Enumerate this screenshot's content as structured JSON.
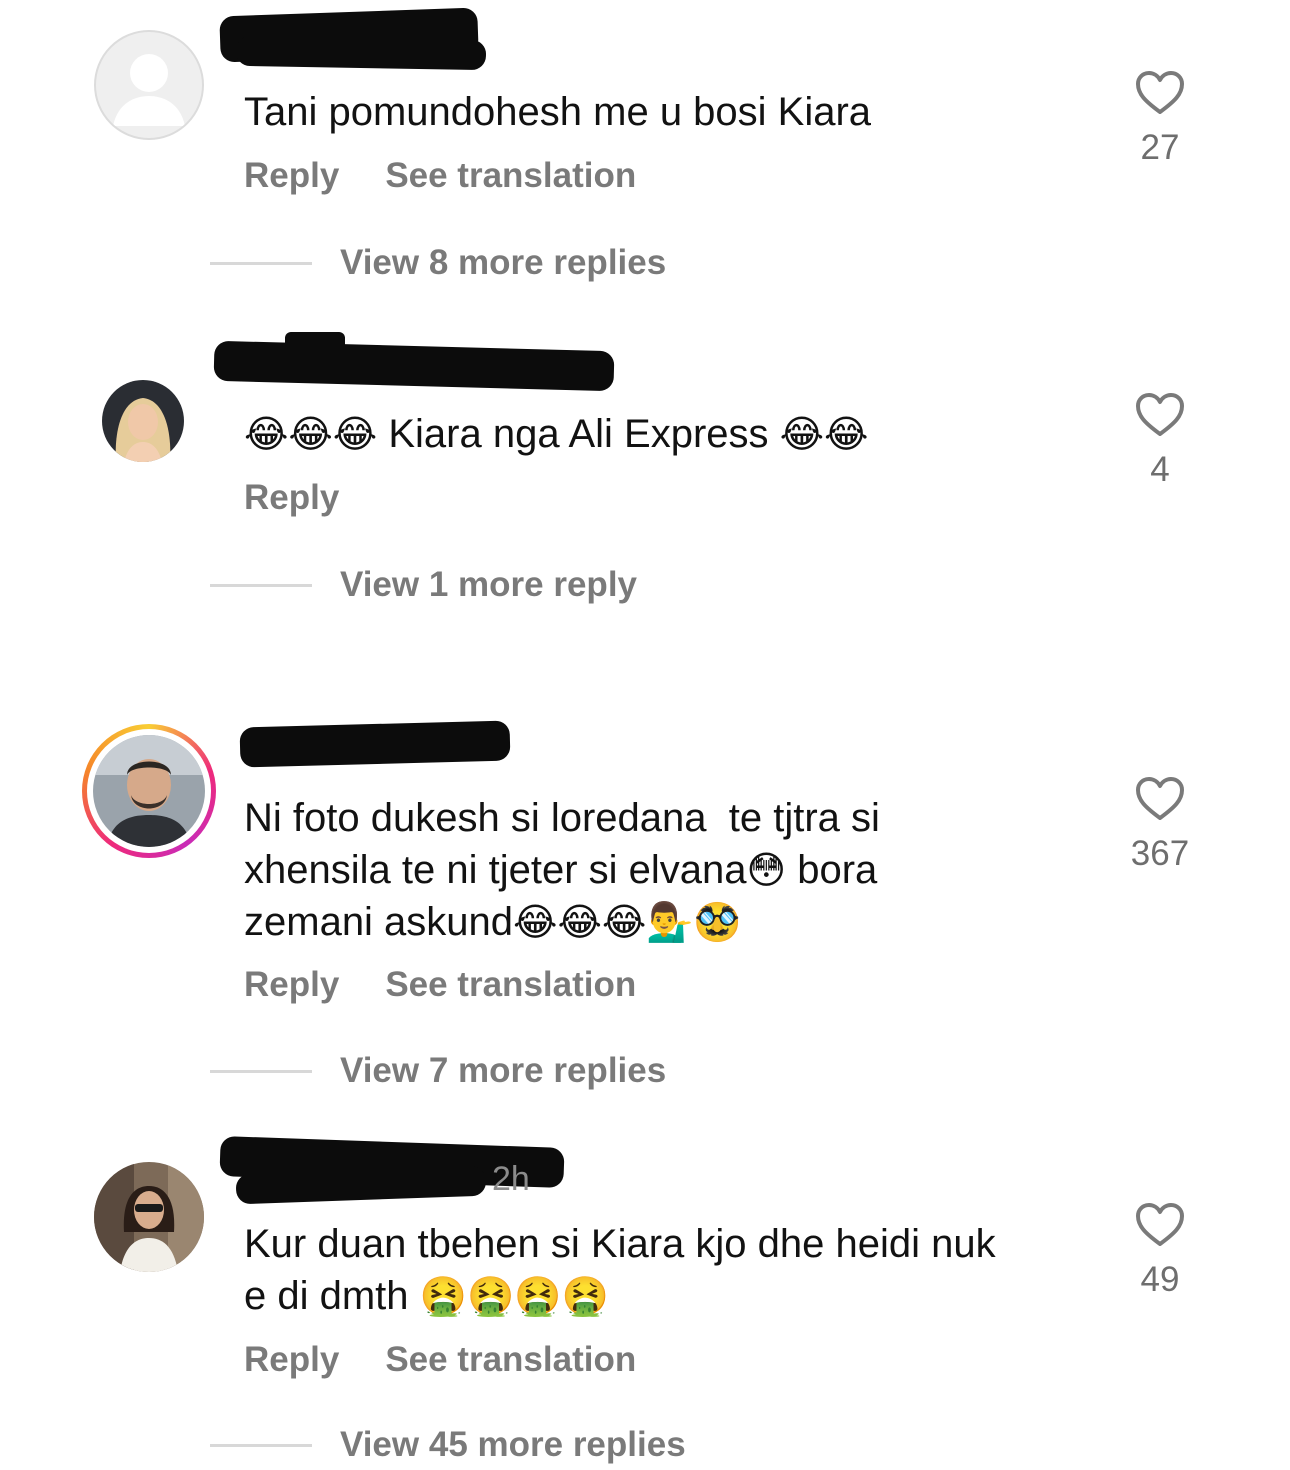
{
  "comments": [
    {
      "username_hidden": true,
      "text": "Tani pomundohesh me u bosi Kiara",
      "actions": {
        "reply": "Reply",
        "translate": "See translation"
      },
      "likes": "27",
      "view_more": "View 8 more replies",
      "avatar": "default-avatar-icon"
    },
    {
      "username_hidden": true,
      "emoji_prefix": "😂😂😂",
      "text": " Kiara nga Ali Express ",
      "emoji_suffix": "😂😂",
      "actions": {
        "reply": "Reply"
      },
      "likes": "4",
      "view_more": "View 1 more reply",
      "avatar": "profile-photo-woman"
    },
    {
      "username_hidden": true,
      "text": "Ni foto dukesh si loredana  te tjtra si\nxhensila te ni tjeter si elvana",
      "emoji_mid": "😳",
      "text_2": " bora\nzemani askund",
      "emoji_suffix": "😂😂😂💁‍♂️🥸",
      "actions": {
        "reply": "Reply",
        "translate": "See translation"
      },
      "likes": "367",
      "view_more": "View 7 more replies",
      "avatar": "profile-photo-man-story-ring"
    },
    {
      "username_hidden": true,
      "timestamp": "2h",
      "text": "Kur duan tbehen si Kiara kjo dhe heidi nuk\ne di dmth ",
      "emoji_suffix": "🤮🤮🤮🤮",
      "actions": {
        "reply": "Reply",
        "translate": "See translation"
      },
      "likes": "49",
      "view_more": "View 45 more replies",
      "avatar": "profile-photo-woman-2"
    }
  ],
  "colors": {
    "text": "#121212",
    "secondary": "#7a7a7a",
    "divider": "#d8d8d8",
    "redaction": "#0c0c0c"
  }
}
